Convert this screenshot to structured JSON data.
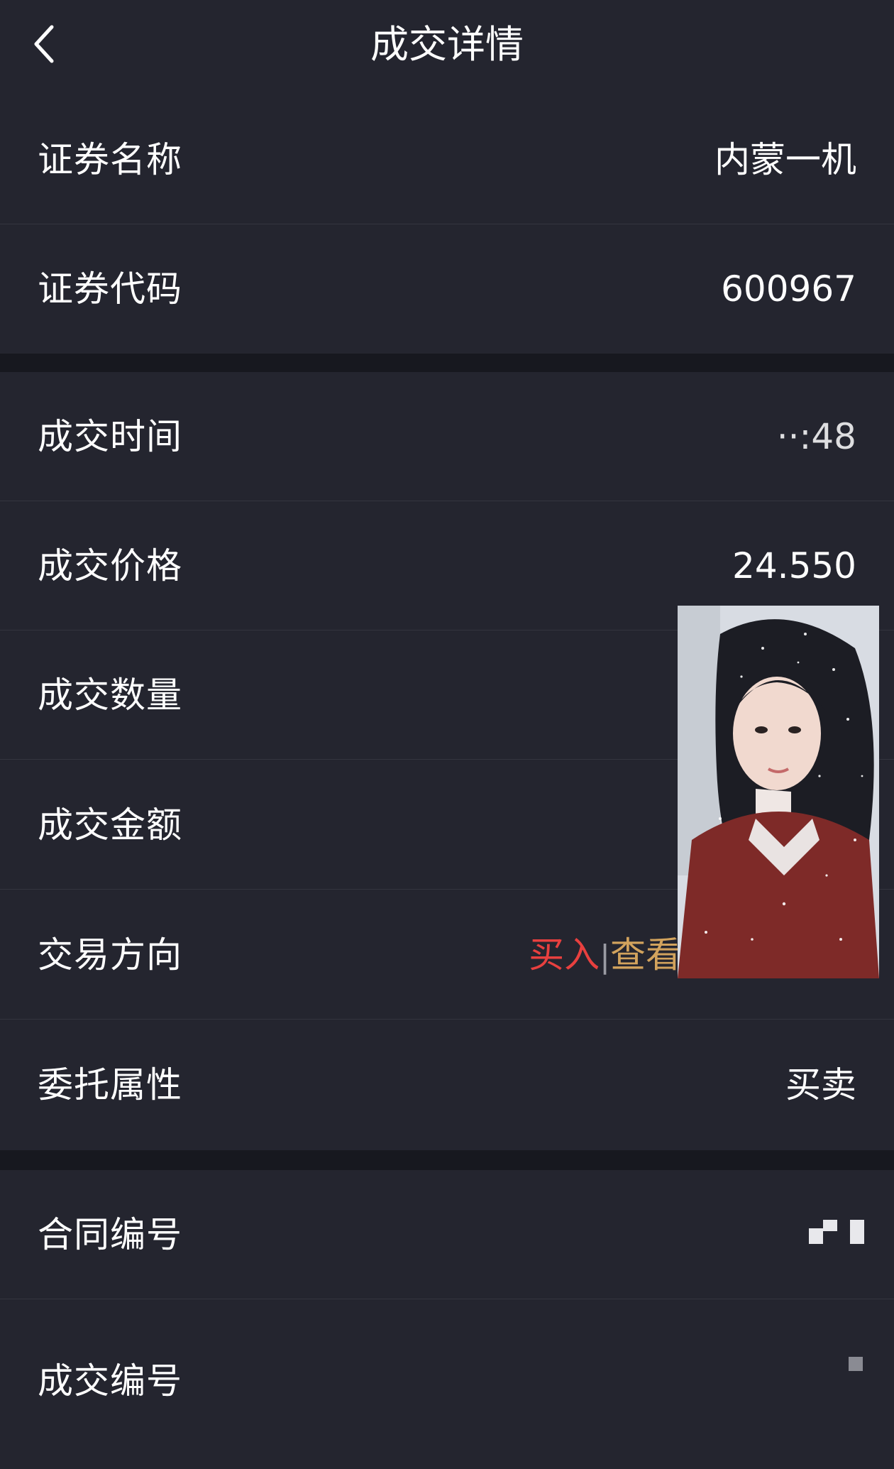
{
  "header": {
    "title": "成交详情"
  },
  "rows": {
    "security_name": {
      "label": "证券名称",
      "value": "内蒙一机"
    },
    "security_code": {
      "label": "证券代码",
      "value": "600967"
    },
    "deal_time": {
      "label": "成交时间",
      "value": "··:48"
    },
    "deal_price": {
      "label": "成交价格",
      "value": "24.550"
    },
    "deal_quantity": {
      "label": "成交数量",
      "value": ""
    },
    "deal_amount": {
      "label": "成交金额",
      "value": ""
    },
    "trade_direction": {
      "label": "交易方向",
      "value_buy": "买入",
      "separator": "|",
      "value_view": "查看"
    },
    "order_attribute": {
      "label": "委托属性",
      "value": "买卖"
    },
    "contract_no": {
      "label": "合同编号",
      "value": ""
    },
    "deal_no": {
      "label": "成交编号",
      "value": ""
    }
  },
  "colors": {
    "background": "#24252f",
    "divider": "#34353f",
    "section_gap": "#17181f",
    "buy": "#e8403f",
    "view_link": "#d2a35d"
  },
  "icons": {
    "back": "chevron-left-icon"
  }
}
